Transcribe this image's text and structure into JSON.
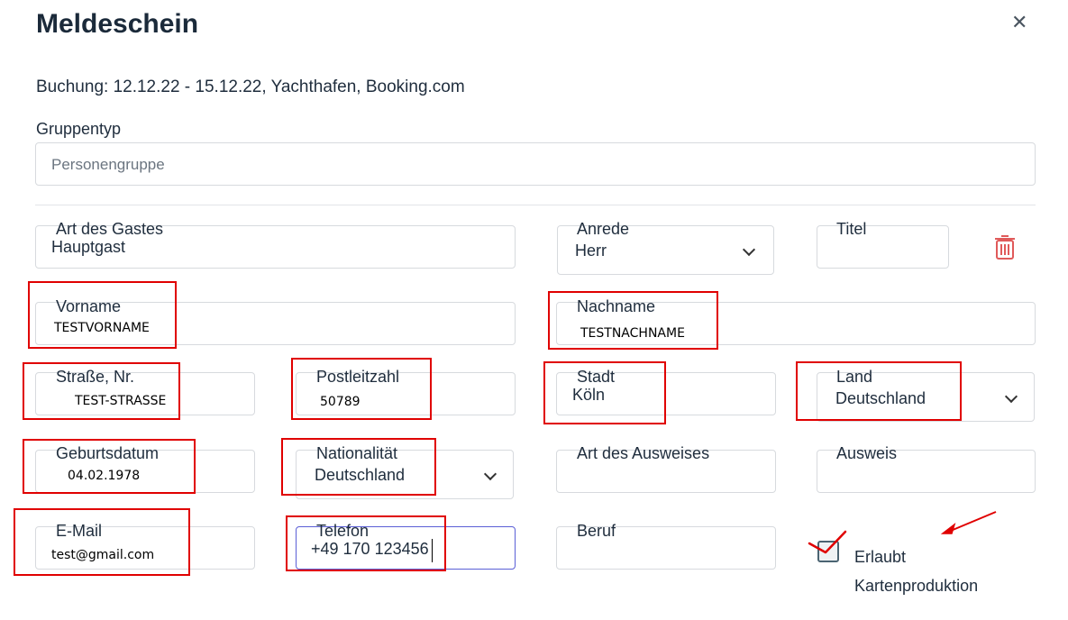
{
  "dialog": {
    "title": "Meldeschein",
    "close_icon": "close-icon",
    "booking": "Buchung: 12.12.22 - 15.12.22, Yachthafen, Booking.com"
  },
  "group": {
    "label": "Gruppentyp",
    "value": "Personengruppe"
  },
  "guest": {
    "art": {
      "label": "Art des Gastes",
      "value": "Hauptgast"
    },
    "anrede": {
      "label": "Anrede",
      "value": "Herr"
    },
    "titel": {
      "label": "Titel",
      "value": ""
    },
    "delete_icon": "trash-icon",
    "vorname": {
      "label": "Vorname",
      "value": "TESTVORNAME"
    },
    "nachname": {
      "label": "Nachname",
      "value": "TESTNACHNAME"
    },
    "strasse": {
      "label": "Straße, Nr.",
      "value": "TEST-STRASSE"
    },
    "plz": {
      "label": "Postleitzahl",
      "value": "50789"
    },
    "stadt": {
      "label": "Stadt",
      "value": "Köln"
    },
    "land": {
      "label": "Land",
      "value": "Deutschland"
    },
    "geburtsdatum": {
      "label": "Geburtsdatum",
      "value": "04.02.1978"
    },
    "nationalitaet": {
      "label": "Nationalität",
      "value": "Deutschland"
    },
    "ausweisart": {
      "label": "Art des Ausweises",
      "value": ""
    },
    "ausweis": {
      "label": "Ausweis",
      "value": ""
    },
    "email": {
      "label": "E-Mail",
      "value": "test@gmail.com"
    },
    "telefon": {
      "label": "Telefon",
      "value": "+49 170 123456"
    },
    "beruf": {
      "label": "Beruf",
      "value": ""
    },
    "karten": {
      "label_line1": "Erlaubt",
      "label_line2": "Kartenproduktion",
      "checked": true
    }
  },
  "colors": {
    "annotation": "#e00000",
    "focus": "#5b5fd6",
    "delete": "#e05a5a"
  }
}
